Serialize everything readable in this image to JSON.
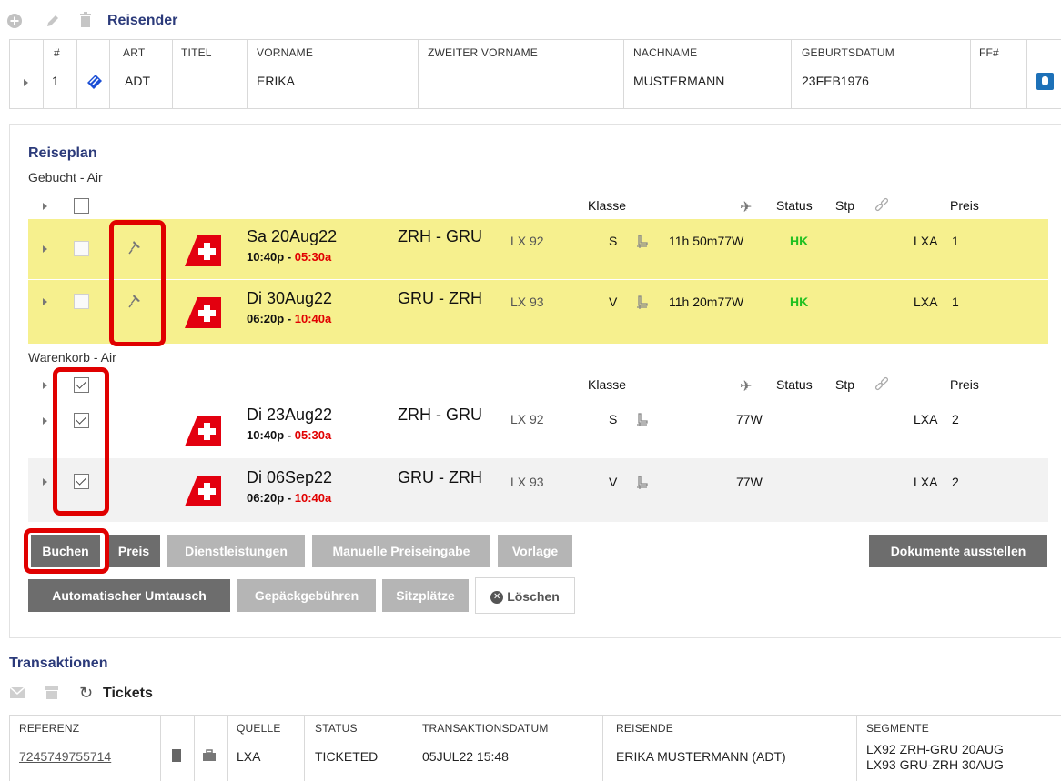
{
  "traveler_section": {
    "title": "Reisender",
    "columns": [
      "#",
      "ART",
      "TITEL",
      "VORNAME",
      "ZWEITER VORNAME",
      "NACHNAME",
      "GEBURTSDATUM",
      "FF#"
    ],
    "row": {
      "num": "1",
      "art": "ADT",
      "titel": "",
      "vorname": "ERIKA",
      "zweiter_vorname": "",
      "nachname": "MUSTERMANN",
      "geburtsdatum": "23FEB1976",
      "ff": ""
    }
  },
  "itinerary": {
    "title": "Reiseplan",
    "booked_label": "Gebucht - Air",
    "cart_label": "Warenkorb - Air",
    "headers": {
      "klasse": "Klasse",
      "status": "Status",
      "stp": "Stp",
      "preis": "Preis"
    },
    "booked": [
      {
        "date": "Sa 20Aug22",
        "dep": "10:40p",
        "sep": " - ",
        "arr": "05:30a",
        "route": "ZRH - GRU",
        "flight": "LX 92",
        "klasse": "S",
        "duration": "11h 50m",
        "equipment": "77W",
        "status": "HK",
        "carrier": "LXA",
        "preis": "1"
      },
      {
        "date": "Di 30Aug22",
        "dep": "06:20p",
        "sep": " - ",
        "arr": "10:40a",
        "route": "GRU - ZRH",
        "flight": "LX 93",
        "klasse": "V",
        "duration": "11h 20m",
        "equipment": "77W",
        "status": "HK",
        "carrier": "LXA",
        "preis": "1"
      }
    ],
    "cart": [
      {
        "date": "Di 23Aug22",
        "dep": "10:40p",
        "sep": " - ",
        "arr": "05:30a",
        "route": "ZRH - GRU",
        "flight": "LX 92",
        "klasse": "S",
        "equipment": "77W",
        "carrier": "LXA",
        "preis": "2"
      },
      {
        "date": "Di 06Sep22",
        "dep": "06:20p",
        "sep": " - ",
        "arr": "10:40a",
        "route": "GRU - ZRH",
        "flight": "LX 93",
        "klasse": "V",
        "equipment": "77W",
        "carrier": "LXA",
        "preis": "2"
      }
    ]
  },
  "buttons": {
    "buchen": "Buchen",
    "preis": "Preis",
    "dienstleistungen": "Dienstleistungen",
    "manuelle": "Manuelle Preiseingabe",
    "vorlage": "Vorlage",
    "dokumente": "Dokumente ausstellen",
    "umtausch": "Automatischer Umtausch",
    "gepaeck": "Gepäckgebühren",
    "sitzplaetze": "Sitzplätze",
    "loeschen": "Löschen"
  },
  "transactions": {
    "title": "Transaktionen",
    "tickets_label": "Tickets",
    "columns": [
      "REFERENZ",
      "QUELLE",
      "STATUS",
      "TRANSAKTIONSDATUM",
      "REISENDE",
      "SEGMENTE"
    ],
    "row": {
      "referenz": "7245749755714",
      "quelle": "LXA",
      "status": "TICKETED",
      "datum": "05JUL22 15:48",
      "reisende": "ERIKA MUSTERMANN (ADT)",
      "segment1": "LX92 ZRH-GRU 20AUG",
      "segment2": "LX93 GRU-ZRH 30AUG"
    }
  },
  "colors": {
    "navy": "#2b3a7a",
    "highlight": "#f6f08e",
    "hk_green": "#20c020",
    "arrival_red": "#e10000",
    "annotation_red": "#e00000",
    "swiss_red": "#e3000f"
  }
}
